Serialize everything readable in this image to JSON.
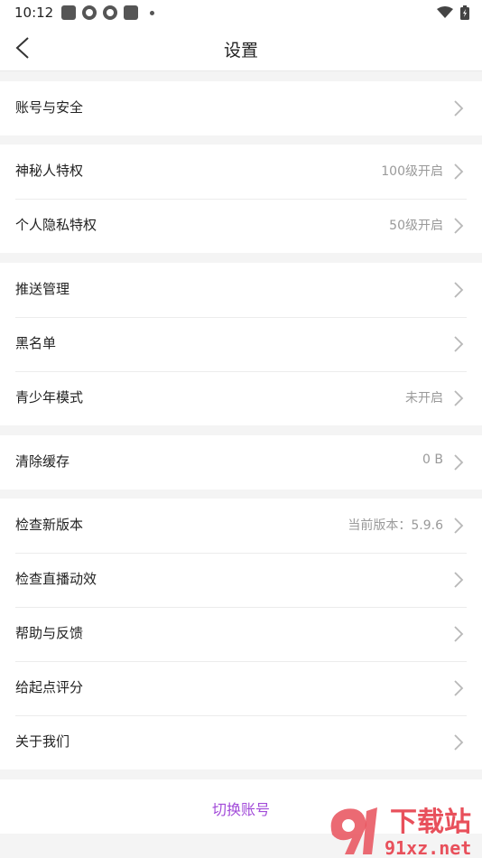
{
  "status_bar": {
    "time": "10:12"
  },
  "header": {
    "title": "设置"
  },
  "groups": [
    {
      "items": [
        {
          "label": "账号与安全",
          "value": ""
        }
      ]
    },
    {
      "items": [
        {
          "label": "神秘人特权",
          "value": "100级开启"
        },
        {
          "label": "个人隐私特权",
          "value": "50级开启"
        }
      ]
    },
    {
      "items": [
        {
          "label": "推送管理",
          "value": ""
        },
        {
          "label": "黑名单",
          "value": ""
        },
        {
          "label": "青少年模式",
          "value": "未开启"
        }
      ]
    },
    {
      "items": [
        {
          "label": "清除缓存",
          "value": "0 B"
        }
      ]
    },
    {
      "items": [
        {
          "label": "检查新版本",
          "value": "当前版本：5.9.6"
        },
        {
          "label": "检查直播动效",
          "value": ""
        },
        {
          "label": "帮助与反馈",
          "value": ""
        },
        {
          "label": "给起点评分",
          "value": ""
        },
        {
          "label": "关于我们",
          "value": ""
        }
      ]
    }
  ],
  "switch_account": {
    "label": "切换账号"
  },
  "watermark": {
    "brand": "下载站",
    "domain": "91xz.net"
  },
  "colors": {
    "accent": "#a24bd9",
    "background": "#f4f4f4",
    "watermark": "#e8505b"
  }
}
